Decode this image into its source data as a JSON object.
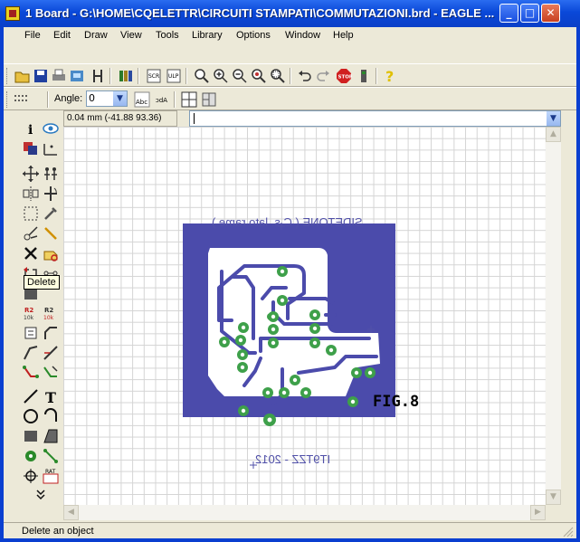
{
  "window": {
    "title": "1 Board - G:\\HOME\\CQELETTR\\CIRCUITI STAMPATI\\COMMUTAZIONI.brd - EAGLE ...",
    "minimize": "_",
    "maximize": "□",
    "close": "✕"
  },
  "menu": [
    "File",
    "Edit",
    "Draw",
    "View",
    "Tools",
    "Library",
    "Options",
    "Window",
    "Help"
  ],
  "params": {
    "angle_label": "Angle:",
    "angle_value": "0"
  },
  "coords": {
    "readout": "0.04 mm (-41.88 93.36)"
  },
  "board": {
    "top_text": "SIDETONE ( C.s. lato rame )",
    "bottom_text": "IT9TZZ - 2012",
    "fig_label": "FIG.8",
    "colors": {
      "copper": "#4b4bab",
      "pad": "#3ea04a",
      "board": "#ffffff",
      "text": "#5050a8"
    }
  },
  "tooltip": "Delete",
  "status": "Delete an object"
}
